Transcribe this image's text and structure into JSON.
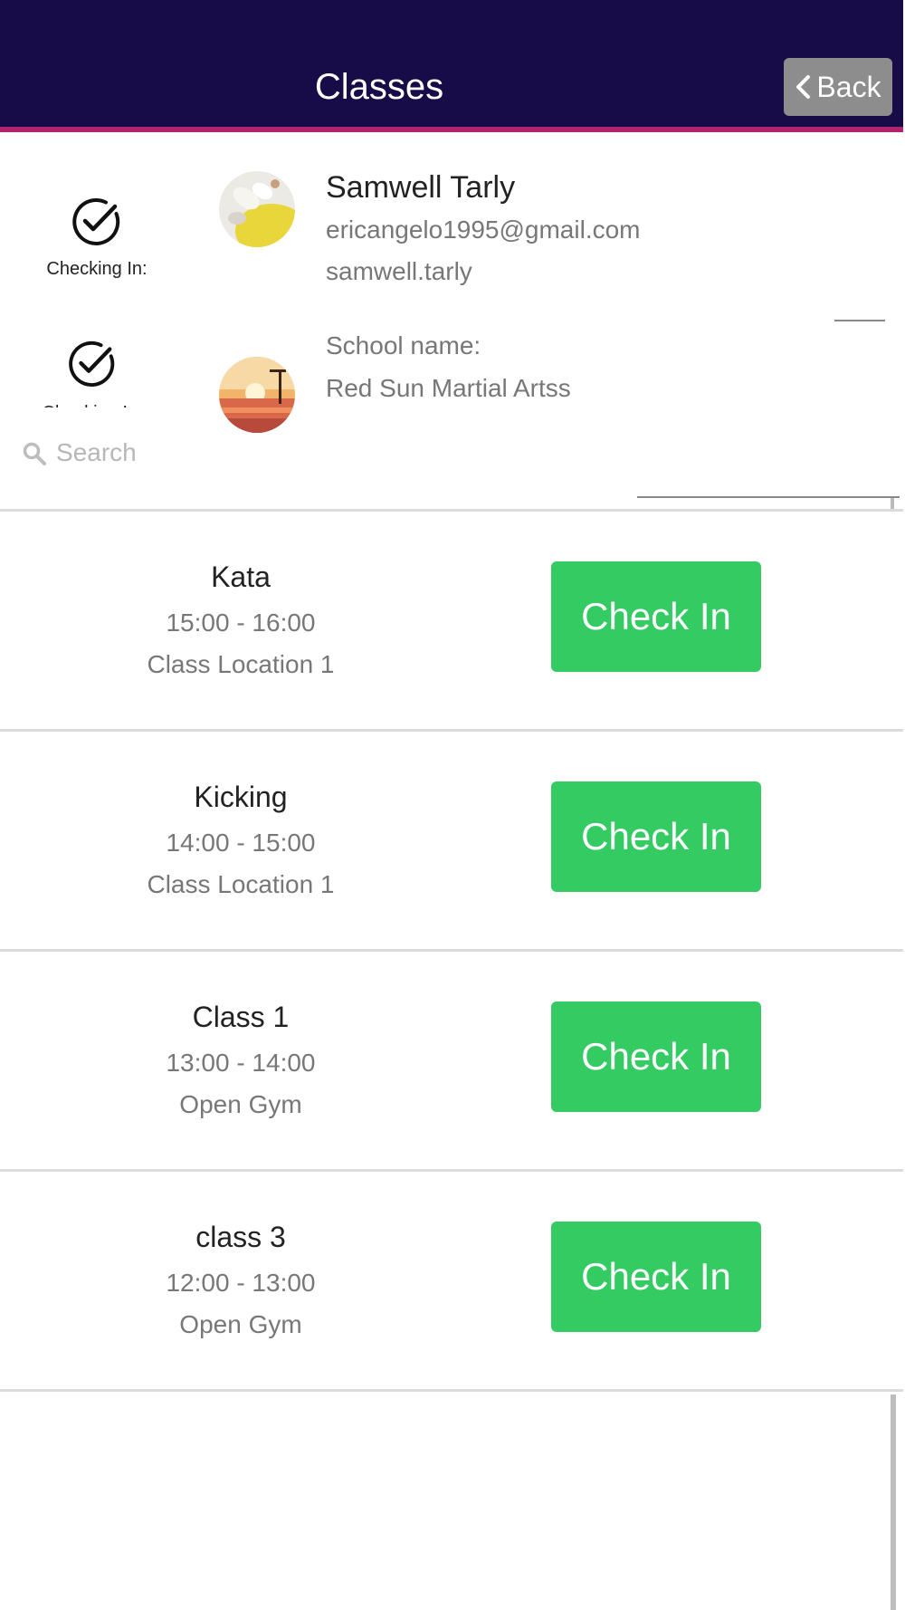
{
  "header": {
    "title": "Classes",
    "back_label": "Back"
  },
  "profile": {
    "checking_in_label": "Checking In:",
    "name": "Samwell Tarly",
    "email": "ericangelo1995@gmail.com",
    "username": "samwell.tarly",
    "school_label": "School name:",
    "school_name": "Red Sun Martial Artss"
  },
  "search": {
    "placeholder": "Search",
    "value": ""
  },
  "classes": [
    {
      "name": "Kata",
      "time": "15:00 - 16:00",
      "location": "Class Location 1",
      "button": "Check In"
    },
    {
      "name": "Kicking",
      "time": "14:00 - 15:00",
      "location": "Class Location 1",
      "button": "Check In"
    },
    {
      "name": "Class 1",
      "time": "13:00 - 14:00",
      "location": "Open Gym",
      "button": "Check In"
    },
    {
      "name": "class 3",
      "time": "12:00 - 13:00",
      "location": "Open Gym",
      "button": "Check In"
    }
  ],
  "colors": {
    "header_background": "#170c48",
    "header_accent": "#b0246e",
    "check_in_button": "#34cb63",
    "back_button": "#8d8d8d"
  },
  "icons": {
    "check": "check-circle-icon",
    "back": "chevron-left-icon",
    "search": "search-icon"
  }
}
